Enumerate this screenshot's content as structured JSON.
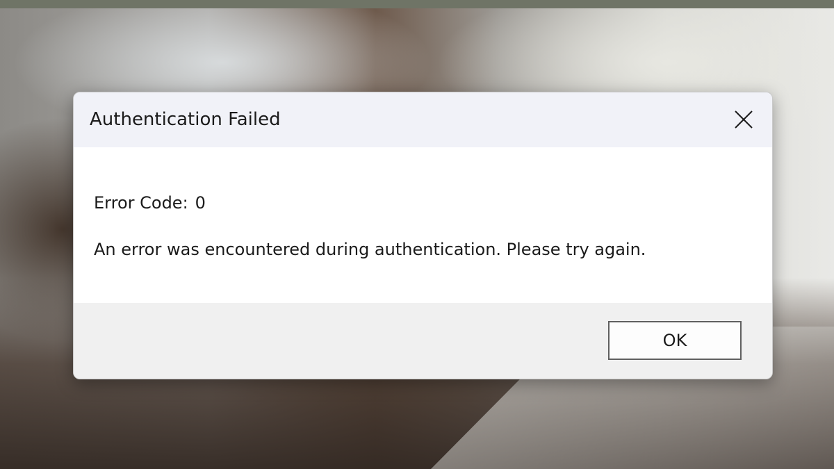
{
  "dialog": {
    "title": "Authentication Failed",
    "close_icon": "close-icon",
    "error_code_label": "Error Code:",
    "error_code_value": "0",
    "message": "An error was encountered during authentication. Please try again.",
    "ok_label": "OK"
  },
  "colors": {
    "titlebar_bg": "#f1f2f8",
    "footer_bg": "#f0f0f0",
    "text": "#1b1b1b",
    "button_border": "#5f5f5f"
  }
}
